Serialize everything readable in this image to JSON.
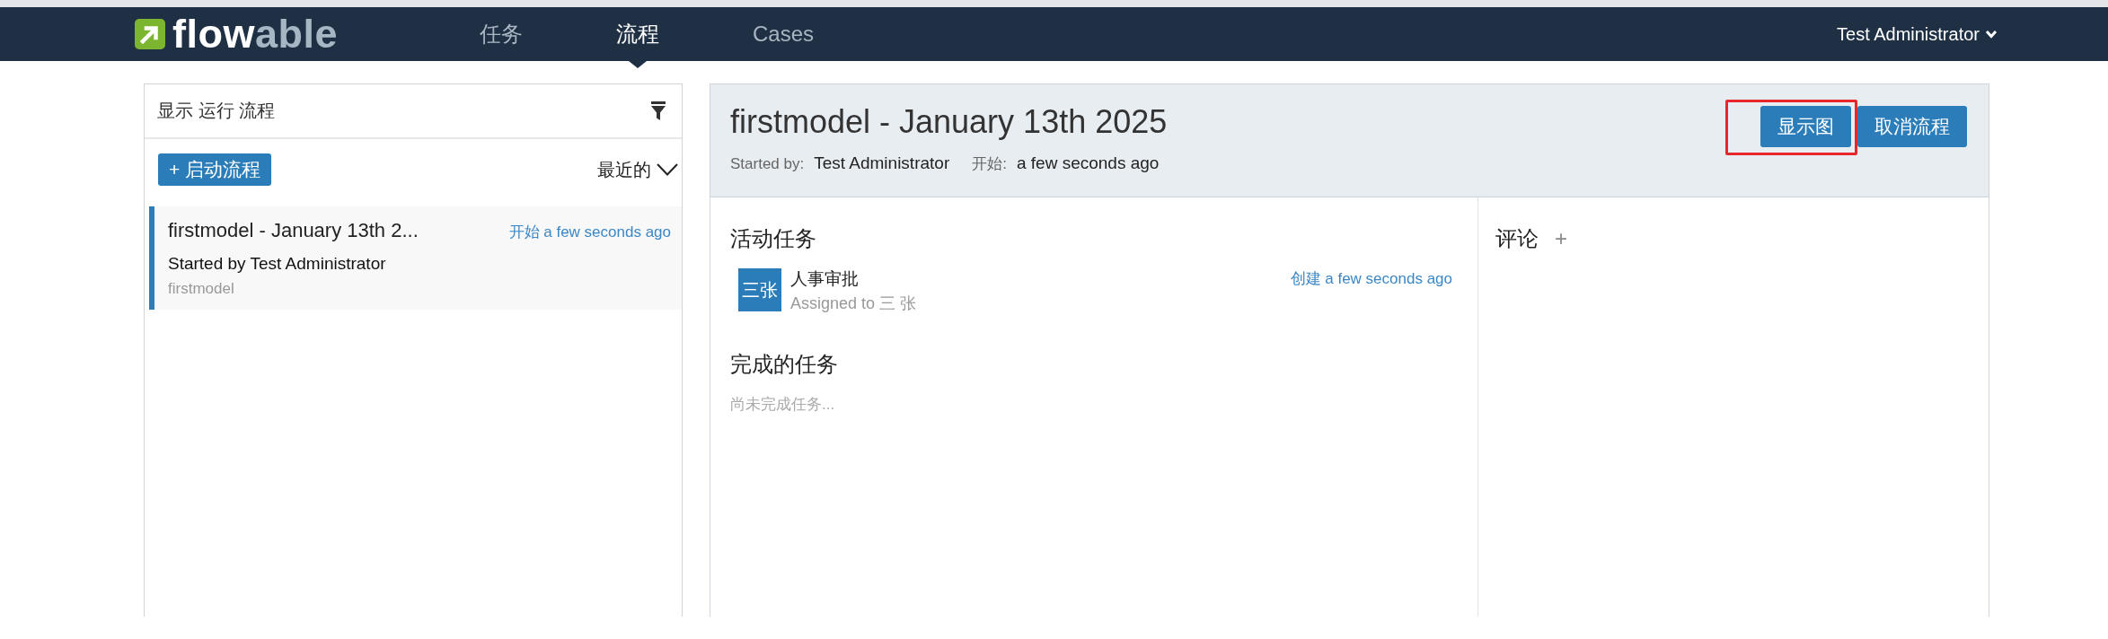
{
  "navbar": {
    "logo": [
      "flow",
      "able"
    ],
    "tabs": [
      {
        "label": "任务",
        "selected": false
      },
      {
        "label": "流程",
        "selected": true
      },
      {
        "label": "Cases",
        "selected": false
      }
    ],
    "user_menu": "Test Administrator"
  },
  "process_list": {
    "title": "显示 运行 流程",
    "start_button": "+ 启动流程",
    "sort": "最近的",
    "items": [
      {
        "title": "firstmodel - January 13th 2...",
        "started": "开始 a few seconds ago",
        "started_by": "Started by Test Administrator",
        "definition": "firstmodel",
        "selected": true
      }
    ]
  },
  "process_detail": {
    "title": "firstmodel - January 13th 2025",
    "meta": [
      {
        "label": "Started by:",
        "value": "Test Administrator"
      },
      {
        "label": "开始:",
        "value": "a few seconds ago"
      }
    ],
    "buttons": [
      {
        "label": "显示图",
        "highlighted": true
      },
      {
        "label": "取消流程",
        "highlighted": false
      }
    ],
    "active_tasks": {
      "heading": "活动任务",
      "tasks": [
        {
          "avatar": "三张",
          "name": "人事审批",
          "assignee": "Assigned to 三 张",
          "created": "创建 a few seconds ago"
        }
      ]
    },
    "completed_tasks": {
      "heading": "完成的任务",
      "empty_text": "尚未完成任务..."
    },
    "comments": {
      "heading": "评论",
      "add": "+"
    }
  }
}
